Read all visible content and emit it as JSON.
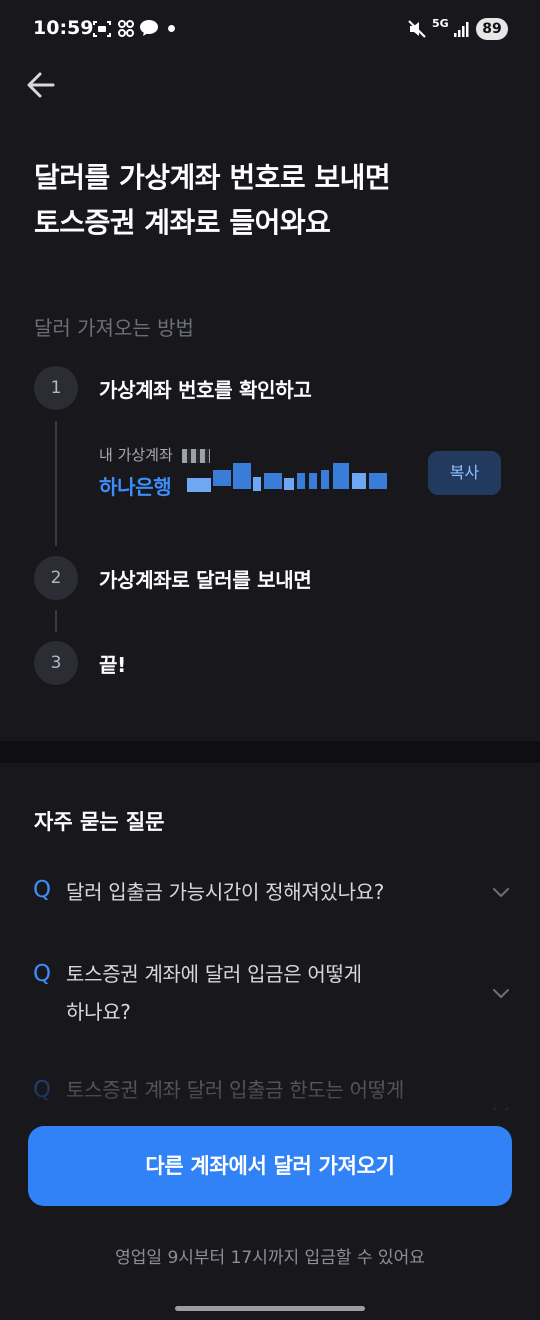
{
  "status_bar": {
    "time": "10:59",
    "battery": "89",
    "network": "5G"
  },
  "header": {
    "back_icon": "arrow-left-icon"
  },
  "title": {
    "line1": "달러를 가상계좌 번호로 보내면",
    "line2": "토스증권 계좌로 들어와요"
  },
  "how_to": {
    "label": "달러 가져오는 방법",
    "steps": [
      {
        "num": "1",
        "text": "가상계좌 번호를 확인하고"
      },
      {
        "num": "2",
        "text": "가상계좌로 달러를 보내면"
      },
      {
        "num": "3",
        "text": "끝!"
      }
    ],
    "account_caption": "내 가상계좌",
    "account_bank": "하나은행",
    "copy_label": "복사"
  },
  "faq": {
    "title": "자주 묻는 질문",
    "q_mark": "Q",
    "items": [
      {
        "text": "달러 입출금 가능시간이 정해져있나요?"
      },
      {
        "line1": "토스증권 계좌에 달러 입금은 어떻게",
        "line2": "하나요?"
      },
      {
        "text": "토스증권 계좌 달러 입출금 한도는 어떻게"
      }
    ]
  },
  "cta": {
    "label": "다른 계좌에서 달러 가져오기"
  },
  "footer_note": "영업일 9시부터 17시까지 입금할 수 있어요",
  "colors": {
    "background": "#17171c",
    "accent": "#3182f6",
    "link_blue": "#3d8dfa"
  }
}
